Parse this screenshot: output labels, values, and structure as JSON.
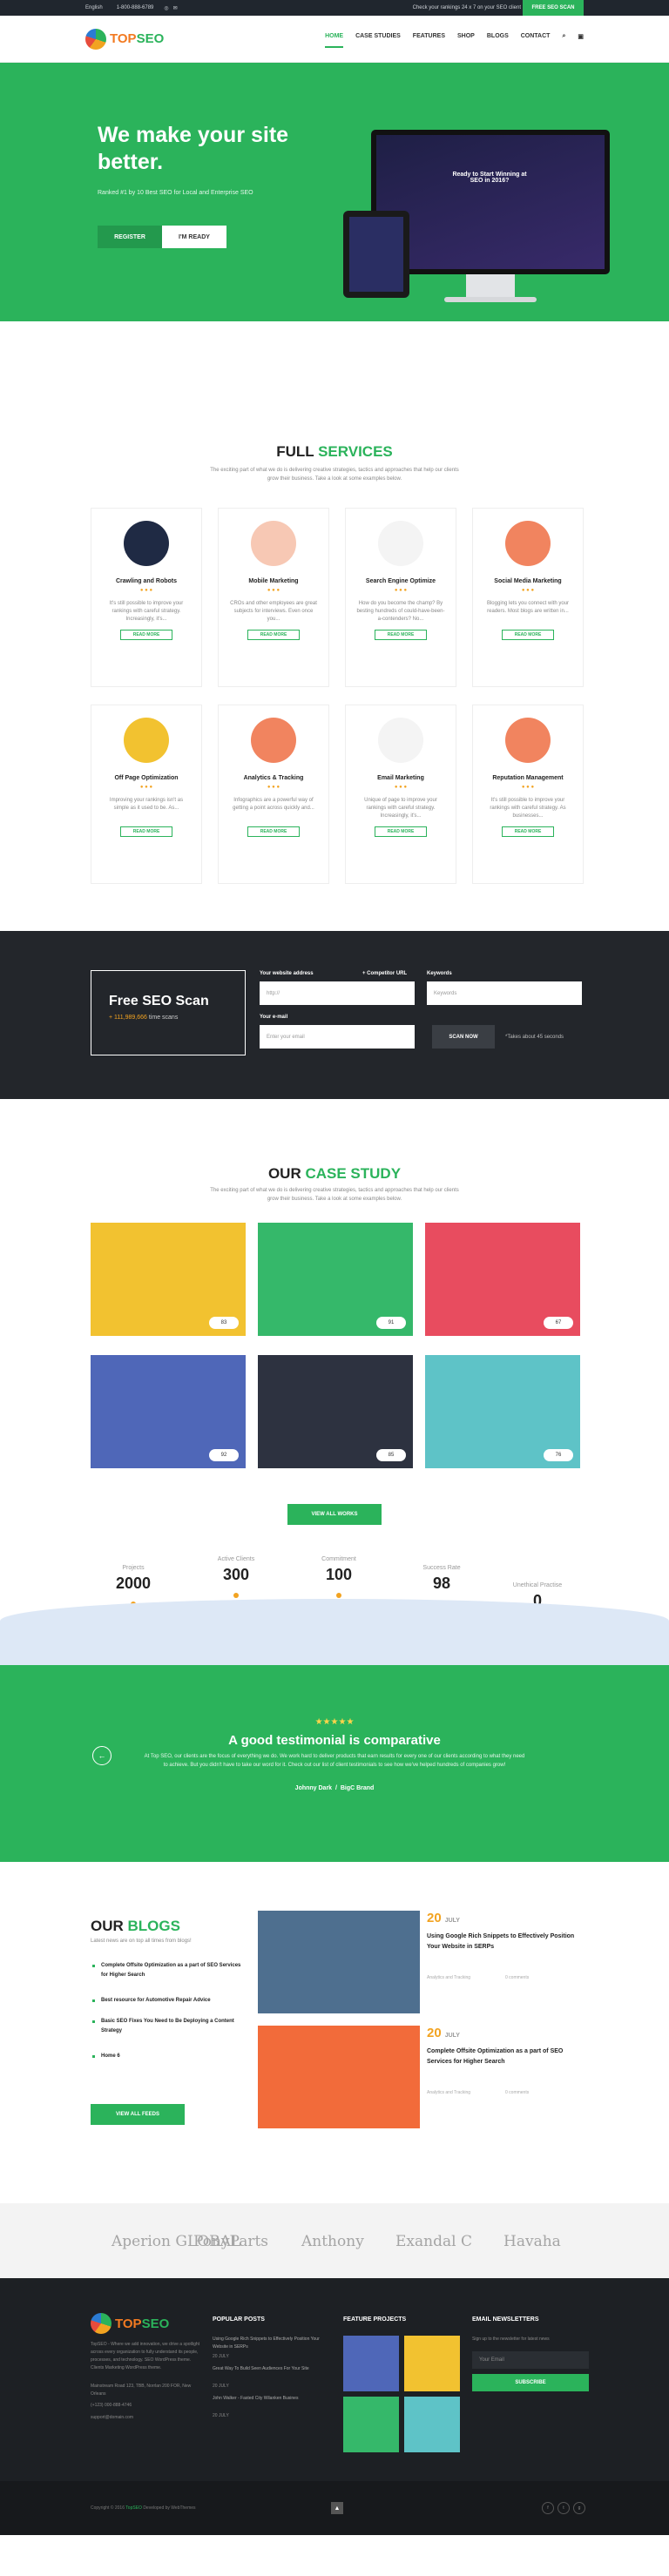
{
  "topbar": {
    "language": "English",
    "phone": "1-800-888-6789",
    "check_text": "Check your rankings 24 x 7 on your SEO client",
    "free_seo_scan": "FREE SEO SCAN"
  },
  "nav": {
    "items": [
      "HOME",
      "CASE STUDIES",
      "FEATURES",
      "SHOP",
      "BLOGS",
      "CONTACT"
    ],
    "logo_top": "TOP",
    "logo_seo": "SEO"
  },
  "hero": {
    "title": "We make your site better.",
    "subtitle": "Ranked #1 by 10 Best SEO for Local and Enterprise SEO",
    "btn_register": "REGISTER",
    "btn_ready": "I'M READY",
    "screen_title": "Ready to Start Winning at SEO in 2016?"
  },
  "services": {
    "title_a": "FULL",
    "title_b": "SERVICES",
    "desc": "The exciting part of what we do is delivering creative strategies, tactics and approaches that help our clients grow their business. Take a look at some examples below.",
    "read_more": "READ MORE",
    "items": [
      {
        "name": "Crawling and Robots",
        "desc": "It's still possible to improve your rankings with careful strategy. Increasingly, it's...",
        "color": "#1f2a44"
      },
      {
        "name": "Mobile Marketing",
        "desc": "CROs and other employees are great subjects for interviews. Even once you...",
        "color": "#f7c8b4"
      },
      {
        "name": "Search Engine Optimize",
        "desc": "How do you become the champ? By besting hundreds of could-have-been-a-contenders? No...",
        "color": "#f4f4f4"
      },
      {
        "name": "Social Media Marketing",
        "desc": "Blogging lets you connect with your readers. Most blogs are written in...",
        "color": "#f1845f"
      },
      {
        "name": "Off Page Optimization",
        "desc": "Improving your rankings isn't as simple as it used to be. As...",
        "color": "#f2c230"
      },
      {
        "name": "Analytics & Tracking",
        "desc": "Infographics are a powerful way of getting a point across quickly and...",
        "color": "#f1845f"
      },
      {
        "name": "Email Marketing",
        "desc": "Unique of page to improve your rankings with careful strategy. Increasingly, it's...",
        "color": "#f4f4f4"
      },
      {
        "name": "Reputation Management",
        "desc": "It's still possible to improve your rankings with careful strategy. As businesses...",
        "color": "#f1845f"
      }
    ]
  },
  "scan": {
    "title": "Free SEO Scan",
    "count": "+ 111,989,666",
    "count_suffix": "time scans",
    "lbl_website": "Your website address",
    "lbl_competitor": "+ Competitor URL",
    "lbl_keywords": "Keywords",
    "lbl_email": "Your e-mail",
    "ph_website": "http://",
    "ph_keywords": "Keywords",
    "ph_email": "Enter your email",
    "btn": "SCAN NOW",
    "note": "*Takes about 45 seconds"
  },
  "case": {
    "title_a": "OUR",
    "title_b": "CASE STUDY",
    "desc": "The exciting part of what we do is delivering creative strategies, tactics and approaches that help our clients grow their business. Take a look at some examples below.",
    "tiles": [
      {
        "color": "#f2c230",
        "pct": "83"
      },
      {
        "color": "#35b86a",
        "pct": "91"
      },
      {
        "color": "#e84c5f",
        "pct": "67"
      },
      {
        "color": "#4f67b8",
        "pct": "92"
      },
      {
        "color": "#2d3240",
        "pct": "85"
      },
      {
        "color": "#5ec3c7",
        "pct": "76"
      }
    ],
    "view_all": "VIEW ALL WORKS"
  },
  "stats": [
    {
      "label": "Projects",
      "value": "2000"
    },
    {
      "label": "Active Clients",
      "value": "300"
    },
    {
      "label": "Commitment",
      "value": "100"
    },
    {
      "label": "Success Rate",
      "value": "98"
    },
    {
      "label": "Unethical Practise",
      "value": "0"
    }
  ],
  "testimonial": {
    "stars": "★★★★★",
    "title": "A good testimonial is comparative",
    "text": "At Top SEO, our clients are the focus of everything we do. We work hard to deliver products that earn results for every one of our clients according to what they need to achieve. But you didn't have to take our word for it. Check out our list of client testimonials to see how we've helped hundreds of companies grow!",
    "author": "Johnny Dark",
    "company": "BigC Brand"
  },
  "blogs": {
    "title_a": "OUR",
    "title_b": "BLOGS",
    "latest": "Latest news are on top all times from blogs!",
    "links": [
      "Complete Offsite Optimization as a part of SEO Services for Higher Search",
      "Best resource for Automotive Repair Advice",
      "Basic SEO Fixes You Need to Be Deploying a Content Strategy",
      "Home 6"
    ],
    "view_all": "VIEW ALL FEEDS",
    "posts": [
      {
        "day": "20",
        "month": "JULY",
        "title": "Using Google Rich Snippets to Effectively Position Your Website in SERPs",
        "cat": "Analytics and Tracking",
        "comments": "0 comments"
      },
      {
        "day": "20",
        "month": "JULY",
        "title": "Complete Offsite Optimization as a part of SEO Services for Higher Search",
        "cat": "Analytics and Tracking",
        "comments": "0 comments"
      }
    ]
  },
  "brands": [
    "Aperion GLOBAL",
    "PonyParts",
    "Anthony",
    "Exandal C",
    "Havaha"
  ],
  "footer": {
    "about": "TopSEO - Where we add innovation, we drive a spotlight across every organization to fully understand its people, processes, and technology. SEO WordPress theme. Clients Marketing WordPress theme.",
    "address": "Mainstream Road 123, TBB, Norrlan 200 FOR, New Orleans",
    "phone": "(+123) 000-888-4746",
    "email": "support@domain.com",
    "h_posts": "POPULAR POSTS",
    "posts": [
      "Using Google Rich Snippets to Effectively Position Your Website in SERPs",
      "Great Way To Build Seen Audiences For Your Site",
      "John Walker - Fasted City Wilanken Busines"
    ],
    "post_date": "20 JULY",
    "h_projects": "FEATURE PROJECTS",
    "h_news": "EMAIL NEWSLETTERS",
    "news_text": "Sign up to the newsletter for latest news",
    "ph_email": "Your Email",
    "subscribe": "SUBSCRIBE",
    "copyright": "Copyright © 2016",
    "copy_brand": "TopSEO",
    "copy_rest": "Developed by WebThemes"
  }
}
